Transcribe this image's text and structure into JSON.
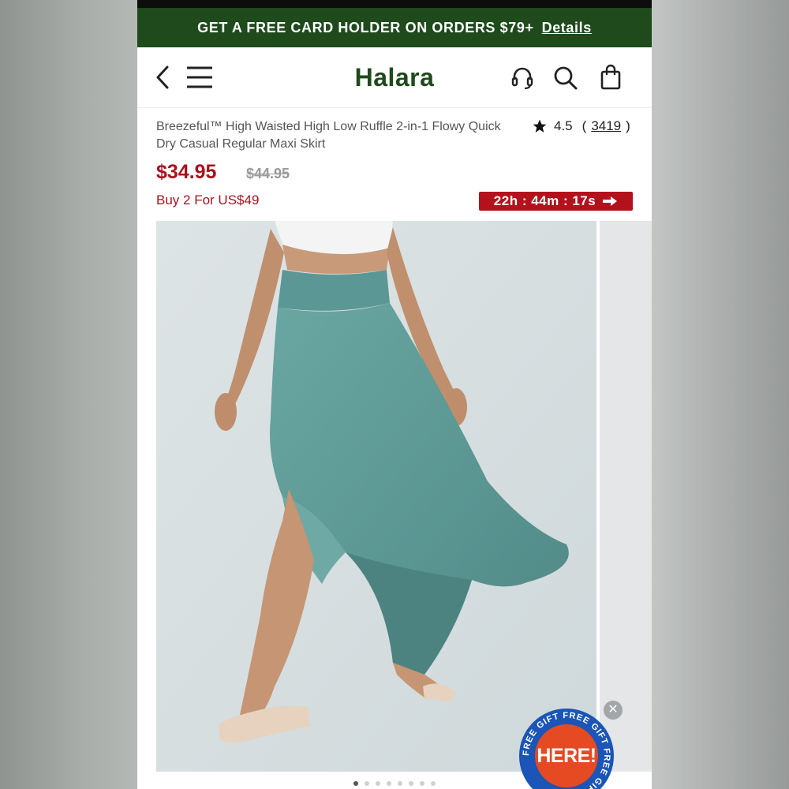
{
  "promo": {
    "text": "GET A FREE CARD HOLDER ON ORDERS $79+",
    "details_label": "Details"
  },
  "header": {
    "brand": "Halara",
    "icons": [
      "back-icon",
      "menu-icon",
      "headset-icon",
      "search-icon",
      "bag-icon"
    ]
  },
  "product": {
    "title": "Breezeful™ High Waisted High Low Ruffle 2-in-1 Flowy Quick Dry Casual Regular Maxi Skirt",
    "rating": "4.5",
    "review_open": "(",
    "review_count": "3419",
    "review_close": ")",
    "price": "$34.95",
    "original_price": "$44.95",
    "bundle_offer": "Buy 2 For US$49",
    "countdown": "22h : 44m : 17s"
  },
  "gallery": {
    "image_count": 8,
    "active_index": 0
  },
  "gift_badge": {
    "ring_text": "FREE GIFT FREE GIFT FREE GIFT",
    "label": "HERE!"
  },
  "colors": {
    "promo_bg": "#1e4a1c",
    "brand": "#1f4a1b",
    "price_red": "#a8121b",
    "timer_bg": "#b3121d",
    "skirt_teal": "#5e9a97",
    "gift_blue": "#1a55b7",
    "gift_orange": "#e54a22"
  }
}
